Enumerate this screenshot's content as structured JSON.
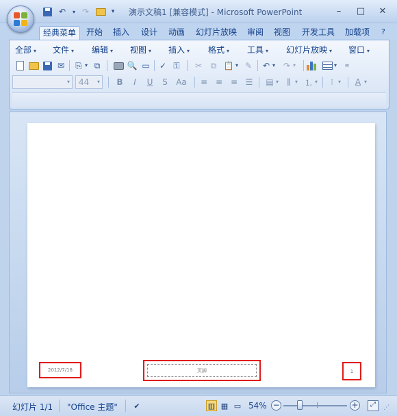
{
  "window": {
    "title": "演示文稿1 [兼容模式] - Microsoft PowerPoint",
    "controls": {
      "minimize": "–",
      "maximize": "□",
      "close": "✕"
    }
  },
  "quick_access": {
    "items": [
      "save-icon",
      "undo-icon",
      "redo-icon",
      "open-icon",
      "customize-icon"
    ],
    "undo": "↶",
    "redo": "↷",
    "customize": "▾"
  },
  "ribbon": {
    "tabs": [
      "经典菜单",
      "开始",
      "插入",
      "设计",
      "动画",
      "幻灯片放映",
      "审阅",
      "视图",
      "开发工具",
      "加载项"
    ],
    "active_tab": "经典菜单",
    "menus": [
      "全部",
      "文件",
      "编辑",
      "视图",
      "插入",
      "格式",
      "工具",
      "幻灯片放映",
      "窗口"
    ],
    "font_name": "",
    "font_size": "44",
    "format_buttons": {
      "bold": "B",
      "italic": "I",
      "underline": "U",
      "strike": "S",
      "case": "Aa"
    },
    "help": "?"
  },
  "slide": {
    "date_footer": "2012/7/18",
    "center_footer": "页脚",
    "slide_number": "1",
    "highlight_color": "#e01b1b"
  },
  "status_bar": {
    "slide_info": "幻灯片 1/1",
    "theme": "\"Office 主题\"",
    "zoom": "54%",
    "zoom_out": "−",
    "zoom_in": "+"
  },
  "colors": {
    "accent": "#15428b",
    "ribbon": "#dfe9f6",
    "workspace": "#c4d7ef"
  }
}
